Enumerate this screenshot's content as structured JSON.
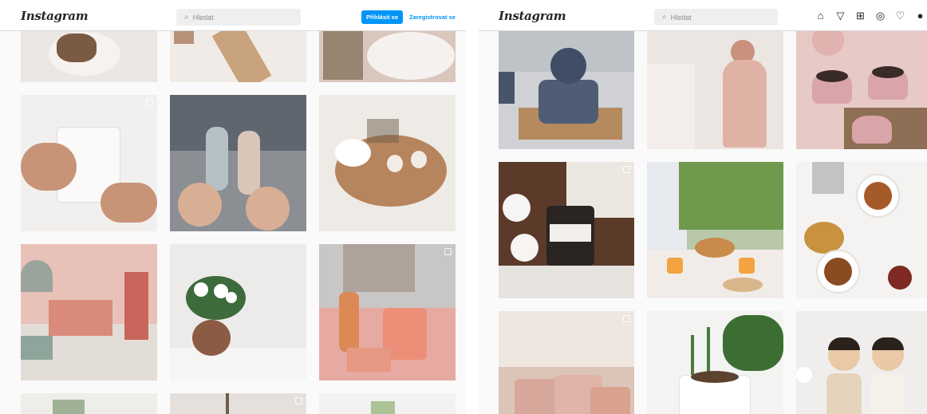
{
  "left": {
    "logo": "Instagram",
    "search_placeholder": "Hledat",
    "login_button": "Přihlásit se",
    "register_link": "Zaregistrovat se"
  },
  "right": {
    "logo": "Instagram",
    "search_placeholder": "Hledat",
    "nav_icons": [
      "home-icon",
      "direct-icon",
      "new-post-icon",
      "explore-icon",
      "activity-icon",
      "profile-icon"
    ]
  },
  "left_tiles": [
    {
      "name": "post-muffin-plate",
      "bg": "#ece7e3",
      "multi": false
    },
    {
      "name": "post-cookies-ribbon",
      "bg": "#f1ebe7",
      "multi": false
    },
    {
      "name": "post-willow-mug",
      "bg": "#d9c6bd",
      "multi": false
    },
    {
      "name": "post-cat-mug",
      "bg": "#f2f0ee",
      "multi": true
    },
    {
      "name": "post-mouse-figures",
      "bg": "#8b8f94",
      "multi": false
    },
    {
      "name": "post-wooden-tray-cup",
      "bg": "#eeeae6",
      "multi": false
    },
    {
      "name": "post-floral-desk-organizer",
      "bg": "#e9cfc7",
      "multi": false
    },
    {
      "name": "post-vase-flowers",
      "bg": "#ecebe9",
      "multi": false
    },
    {
      "name": "post-home-candle",
      "bg": "#c9c6c6",
      "multi": true
    },
    {
      "name": "post-plant-bottom-left",
      "bg": "#efedea",
      "multi": false
    },
    {
      "name": "post-branch-bottom-middle",
      "bg": "#e6e0dc",
      "multi": true
    },
    {
      "name": "post-tulips-bottom-right",
      "bg": "#f2f2f0",
      "multi": false
    }
  ],
  "right_tiles": [
    {
      "name": "post-blue-dishes",
      "bg": "#cfd1d4",
      "multi": false
    },
    {
      "name": "post-couple-figurine",
      "bg": "#ece6e3",
      "multi": false
    },
    {
      "name": "post-chocolate-cupcakes",
      "bg": "#e7c9c5",
      "multi": false
    },
    {
      "name": "post-cotton-candle",
      "bg": "#5b3a2a",
      "multi": true
    },
    {
      "name": "post-garden-breakfast",
      "bg": "#b9c8a8",
      "multi": false
    },
    {
      "name": "post-tea-flatlay",
      "bg": "#f4f3f2",
      "multi": false
    },
    {
      "name": "post-pink-mugs",
      "bg": "#dcc4b8",
      "multi": true
    },
    {
      "name": "post-potted-plant",
      "bg": "#f3f3f1",
      "multi": false
    },
    {
      "name": "post-wooden-dolls",
      "bg": "#f0eeec",
      "multi": false
    }
  ],
  "colors": {
    "accent": "#0095f6",
    "border": "#dbdbdb",
    "page_bg": "#fafafa"
  }
}
